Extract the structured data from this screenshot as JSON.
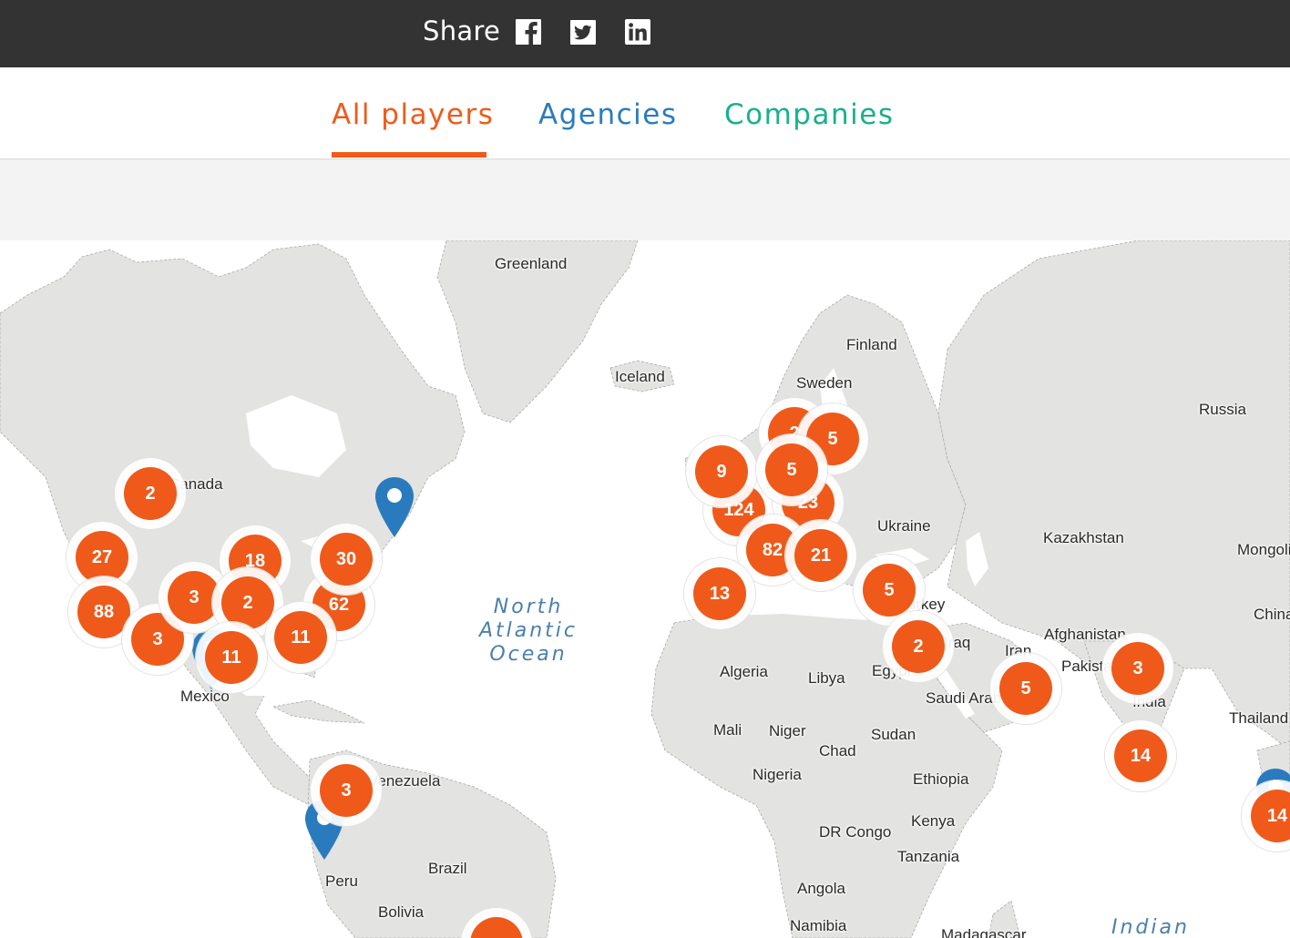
{
  "share": {
    "label": "Share",
    "buttons": [
      {
        "name": "facebook",
        "icon": "facebook-icon"
      },
      {
        "name": "twitter",
        "icon": "twitter-icon"
      },
      {
        "name": "linkedin",
        "icon": "linkedin-icon"
      }
    ]
  },
  "tabs": [
    {
      "label": "All players",
      "active": true,
      "color": "#ef5a1a"
    },
    {
      "label": "Agencies",
      "active": false,
      "color": "#2a7bbd"
    },
    {
      "label": "Companies",
      "active": false,
      "color": "#19b08e"
    }
  ],
  "colors": {
    "accent": "#ef5a1a",
    "agencies": "#2a7bbd",
    "companies": "#19b08e",
    "land": "#e3e3e1",
    "water": "#ffffff",
    "header": "#333333"
  },
  "map": {
    "place_labels": [
      "Greenland",
      "Iceland",
      "Finland",
      "Sweden",
      "Russia",
      "Canada",
      "Ukraine",
      "Kazakhstan",
      "Mongolia",
      "China",
      "Afghanistan",
      "Iran",
      "Iraq",
      "Turkey",
      "Pakistan",
      "India",
      "Thailand",
      "Saudi Arabia",
      "Egypt",
      "Algeria",
      "Libya",
      "Mali",
      "Niger",
      "Chad",
      "Sudan",
      "Nigeria",
      "Ethiopia",
      "DR Congo",
      "Kenya",
      "Tanzania",
      "Angola",
      "Namibia",
      "Madagascar",
      "Mexico",
      "Venezuela",
      "Peru",
      "Brazil",
      "Bolivia",
      "North Atlantic Ocean",
      "Indian"
    ],
    "clusters": [
      2,
      27,
      88,
      3,
      18,
      3,
      2,
      11,
      11,
      30,
      62,
      3,
      9,
      2,
      5,
      5,
      124,
      23,
      82,
      21,
      13,
      5,
      2,
      5,
      3,
      14,
      14
    ],
    "pins": [
      {
        "type": "agency",
        "region": "Eastern Canada"
      },
      {
        "type": "agency",
        "region": "Mexico"
      },
      {
        "type": "agency",
        "region": "Peru"
      },
      {
        "type": "agency",
        "region": "Southeast Asia"
      }
    ]
  }
}
